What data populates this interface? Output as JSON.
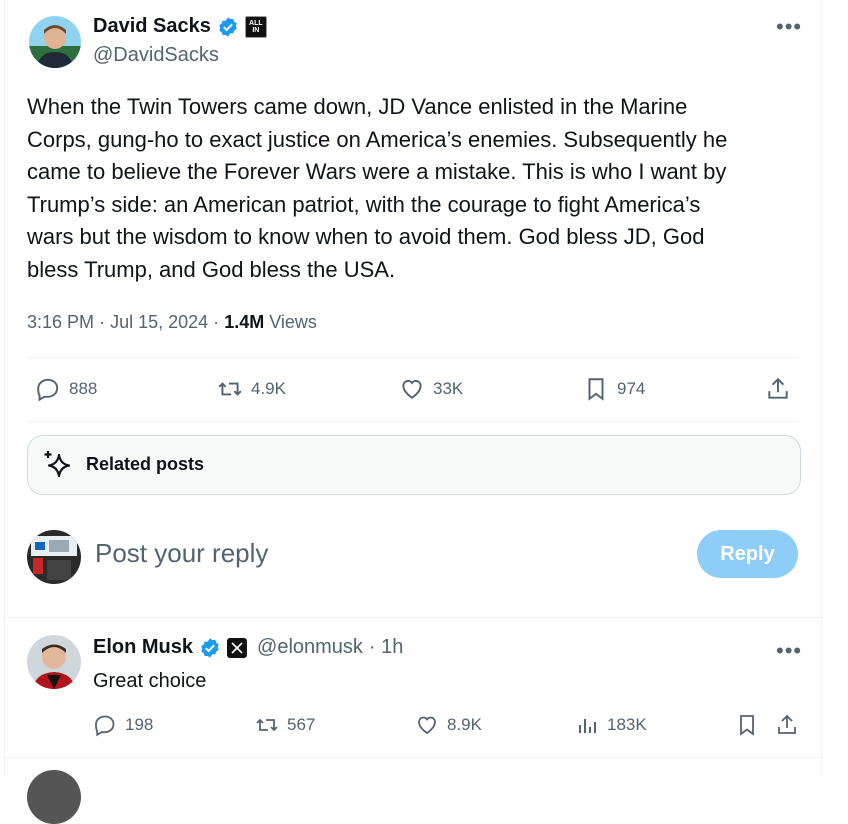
{
  "main_tweet": {
    "author_name": "David Sacks",
    "author_handle": "@DavidSacks",
    "badge_text": "ALL IN",
    "text_lines": [
      "When the Twin Towers came down, JD Vance enlisted in the Marine",
      "Corps, gung-ho to exact justice on America’s enemies. Subsequently he",
      "came to believe the Forever Wars were a mistake. This is who I want by",
      "Trump’s side: an American patriot, with the courage to fight America’s",
      "wars but the wisdom to know when to avoid them. God bless JD, God",
      "bless Trump, and God bless the USA."
    ],
    "time": "3:16 PM",
    "dot": "·",
    "date": "Jul 15, 2024",
    "views_count": "1.4M",
    "views_label": "Views",
    "stats": {
      "replies": "888",
      "reposts": "4.9K",
      "likes": "33K",
      "bookmarks": "974"
    }
  },
  "related_posts_label": "Related posts",
  "composer": {
    "placeholder": "Post your reply",
    "reply_button": "Reply"
  },
  "reply": {
    "author_name": "Elon Musk",
    "author_handle": "@elonmusk",
    "time_ago": "· 1h",
    "text": "Great choice",
    "stats": {
      "replies": "198",
      "reposts": "567",
      "likes": "8.9K",
      "views": "183K"
    }
  },
  "colors": {
    "verified_blue": "#1d9bf0",
    "reply_button_bg": "#8ecdf8",
    "secondary_text": "#536471",
    "border": "#eff3f4"
  }
}
